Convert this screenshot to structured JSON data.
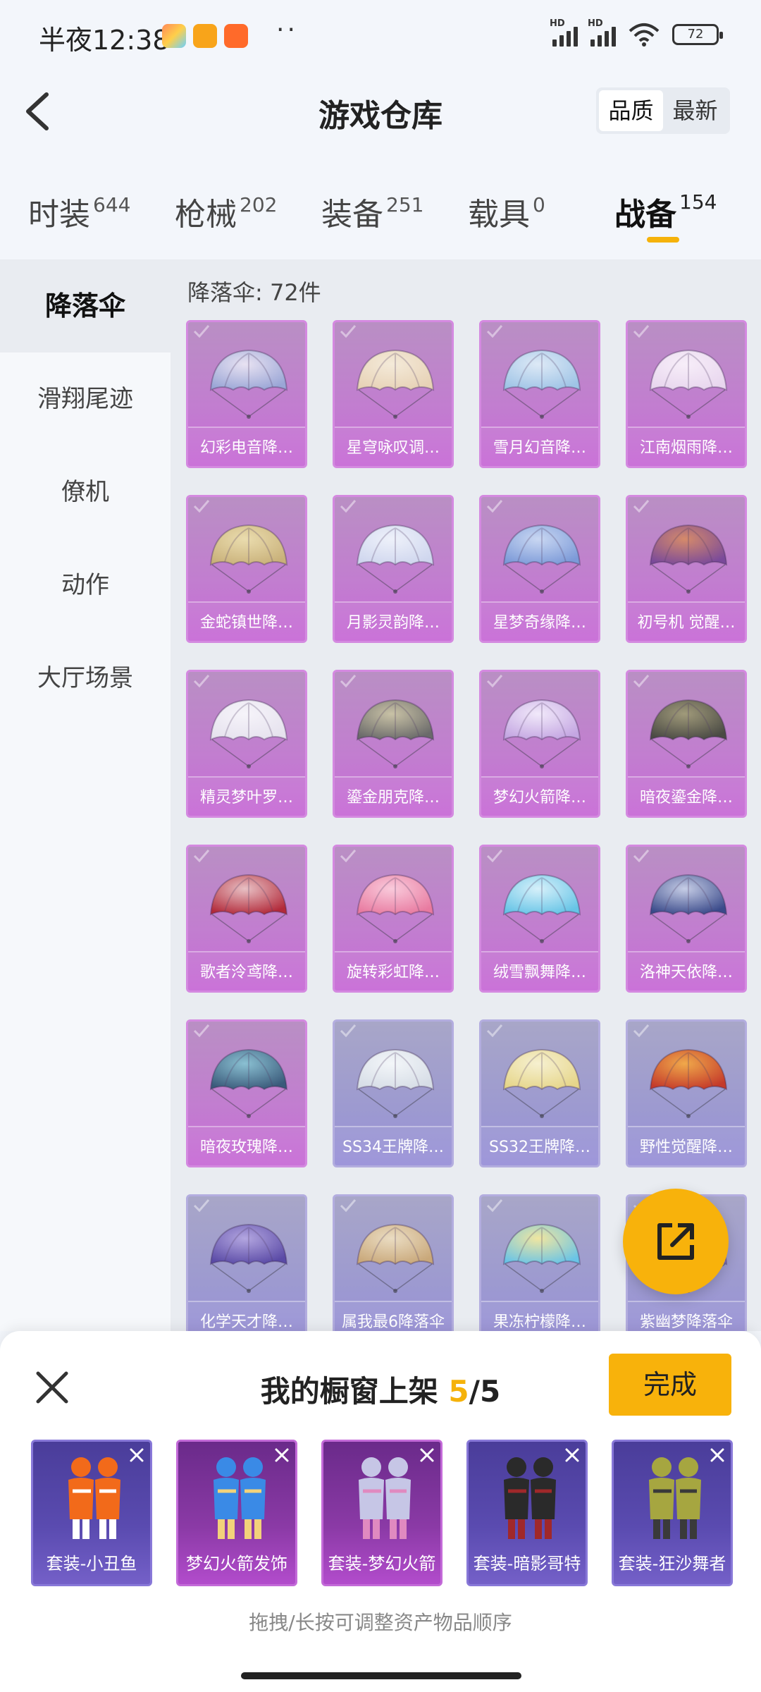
{
  "status_bar": {
    "time": "半夜12:38",
    "app_icons": [
      "game-center-icon",
      "notes-icon",
      "shop-icon"
    ],
    "overflow": "··",
    "signal_labels": [
      "HD",
      "HD"
    ],
    "battery": "72"
  },
  "header": {
    "title": "游戏仓库",
    "sort_options": [
      "品质",
      "最新"
    ],
    "active_sort": "品质"
  },
  "categories": [
    {
      "name": "时装",
      "count": "644"
    },
    {
      "name": "枪械",
      "count": "202"
    },
    {
      "name": "装备",
      "count": "251"
    },
    {
      "name": "载具",
      "count": "0"
    },
    {
      "name": "战备",
      "count": "154"
    }
  ],
  "active_category": "战备",
  "sidebar": {
    "items": [
      "降落伞",
      "滑翔尾迹",
      "僚机",
      "动作",
      "大厅场景"
    ],
    "active": "降落伞"
  },
  "content": {
    "heading": "降落伞: 72件",
    "items": [
      {
        "label": "幻彩电音降…",
        "tier": "purple",
        "c1": "#9aa6d6",
        "c2": "#e8e2f2"
      },
      {
        "label": "星穹咏叹调…",
        "tier": "purple",
        "c1": "#e7d2b6",
        "c2": "#f4ead9"
      },
      {
        "label": "雪月幻音降…",
        "tier": "purple",
        "c1": "#9fc4e6",
        "c2": "#dde9f6"
      },
      {
        "label": "江南烟雨降…",
        "tier": "purple",
        "c1": "#e8d6ee",
        "c2": "#f7eef9"
      },
      {
        "label": "金蛇镇世降…",
        "tier": "purple",
        "c1": "#c9b17a",
        "c2": "#eadcae"
      },
      {
        "label": "月影灵韵降…",
        "tier": "purple",
        "c1": "#cfd6ee",
        "c2": "#eef1fa"
      },
      {
        "label": "星梦奇缘降…",
        "tier": "purple",
        "c1": "#7c9ad8",
        "c2": "#c9d7f2"
      },
      {
        "label": "初号机 觉醒…",
        "tier": "purple",
        "c1": "#7a4a9a",
        "c2": "#d58a6a"
      },
      {
        "label": "精灵梦叶罗…",
        "tier": "purple",
        "c1": "#e6e2ee",
        "c2": "#f6f4fa"
      },
      {
        "label": "鎏金朋克降…",
        "tier": "purple",
        "c1": "#6a6a6a",
        "c2": "#c9c2a6"
      },
      {
        "label": "梦幻火箭降…",
        "tier": "purple",
        "c1": "#c4a6e2",
        "c2": "#f1e9fa"
      },
      {
        "label": "暗夜鎏金降…",
        "tier": "purple",
        "c1": "#4a4a44",
        "c2": "#a09a7a"
      },
      {
        "label": "歌者泠鸢降…",
        "tier": "purple",
        "c1": "#b22a3a",
        "c2": "#e8c0c4"
      },
      {
        "label": "旋转彩虹降…",
        "tier": "purple",
        "c1": "#e87aa0",
        "c2": "#f9cadb"
      },
      {
        "label": "绒雪飘舞降…",
        "tier": "purple",
        "c1": "#66c4e6",
        "c2": "#d6f0fa"
      },
      {
        "label": "洛神天依降…",
        "tier": "purple",
        "c1": "#3a4a8a",
        "c2": "#c6cde6"
      },
      {
        "label": "暗夜玫瑰降…",
        "tier": "purple",
        "c1": "#3a5a7a",
        "c2": "#8ac0d2"
      },
      {
        "label": "SS34王牌降…",
        "tier": "blue",
        "c1": "#d6dde6",
        "c2": "#f3f6f9"
      },
      {
        "label": "SS32王牌降…",
        "tier": "blue",
        "c1": "#e6d68a",
        "c2": "#f6f0d0"
      },
      {
        "label": "野性觉醒降…",
        "tier": "blue",
        "c1": "#c43a2a",
        "c2": "#f0a84a"
      },
      {
        "label": "化学天才降…",
        "tier": "blue",
        "c1": "#5a4aa6",
        "c2": "#b3a6e0"
      },
      {
        "label": "属我最6降落伞",
        "tier": "blue",
        "c1": "#c9a87a",
        "c2": "#eadcc2"
      },
      {
        "label": "果冻柠檬降…",
        "tier": "blue",
        "c1": "#6ac4e6",
        "c2": "#f0e6a0"
      },
      {
        "label": "紫幽梦降落伞",
        "tier": "blue",
        "c1": "#8a7ad0",
        "c2": "#cfc6f0"
      }
    ]
  },
  "share_button": {
    "icon": "share-icon"
  },
  "showcase": {
    "title_prefix": "我的橱窗上架",
    "count": "5",
    "total": "/5",
    "done_label": "完成",
    "items": [
      {
        "label": "套装-小丑鱼",
        "tier": "blue",
        "c1": "#f26a1a",
        "c2": "#ffffff"
      },
      {
        "label": "梦幻火箭发饰",
        "tier": "purple",
        "c1": "#3a8ae6",
        "c2": "#f2d27a"
      },
      {
        "label": "套装-梦幻火箭",
        "tier": "purple",
        "c1": "#c6c6e6",
        "c2": "#e08ac0"
      },
      {
        "label": "套装-暗影哥特",
        "tier": "blue",
        "c1": "#2a2a2a",
        "c2": "#a0282a"
      },
      {
        "label": "套装-狂沙舞者",
        "tier": "blue",
        "c1": "#a6a640",
        "c2": "#3a3a3a"
      }
    ],
    "hint": "拖拽/长按可调整资产物品顺序"
  }
}
